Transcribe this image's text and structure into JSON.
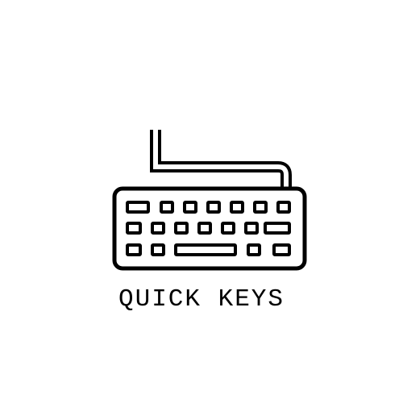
{
  "brand": {
    "name": "QUICK KEYS",
    "icon": "keyboard-icon",
    "colors": {
      "ink": "#000000",
      "background": "#ffffff"
    }
  }
}
